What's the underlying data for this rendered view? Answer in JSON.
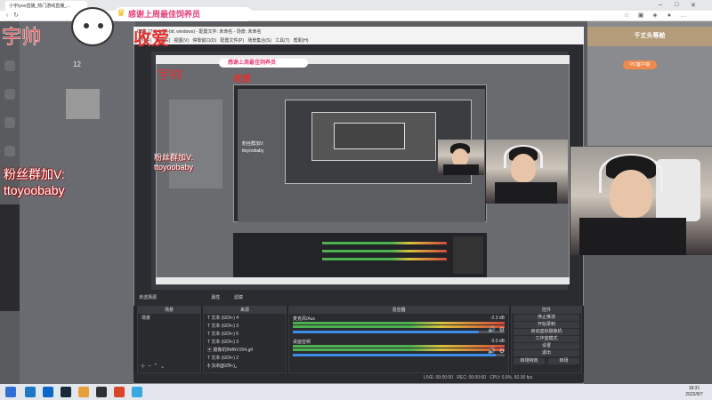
{
  "browser": {
    "tab_title": "小宇tyoo直播_热门游戏直播_...",
    "title_icons": [
      "minimize-icon",
      "maximize-icon",
      "close-icon"
    ]
  },
  "overlay": {
    "streamer_name": "宇帅",
    "gift_text": "收爱",
    "banner_text": "感谢上周最佳饲养员",
    "fan_group_label": "粉丝群加V:",
    "fan_group_id": "ttoyoobaby"
  },
  "page": {
    "left_count": "12",
    "right_banner": "千丈头等舱",
    "pc_button": "PC客户端"
  },
  "obs": {
    "title": "OBS 27.2.4 (64-bit, windows) - 配置文件: 未命名 - 场景: 未命名",
    "menu": [
      "文件(F)",
      "编辑(E)",
      "视图(V)",
      "停靠窗口(D)",
      "配置文件(P)",
      "场景集合(S)",
      "工具(T)",
      "帮助(H)"
    ],
    "no_source_label": "未选择源",
    "properties_label": "属性",
    "filters_label": "滤镜",
    "scenes": {
      "header": "场景",
      "items": [
        "场景"
      ]
    },
    "sources": {
      "header": "来源",
      "items": [
        "文本 (GDI+) 4",
        "文本 (GDI+) 3",
        "文本 (GDI+) 5",
        "文本 (GDI+) 3",
        "摄像机BMNV204.gif",
        "文本 (GDI+) 2",
        "文本 (GDI+)"
      ]
    },
    "mixer": {
      "header": "混音器",
      "tracks": [
        {
          "name": "麦克风/Aux",
          "db": "-2.3 dB"
        },
        {
          "name": "桌面音频",
          "db": "0.0 dB"
        }
      ]
    },
    "controls": {
      "header": "控件",
      "buttons": [
        "停止推流",
        "开始录制",
        "启动虚拟摄像机",
        "工作室模式",
        "设置",
        "退出"
      ]
    },
    "transition": {
      "label": "转场特效",
      "button": "转场"
    },
    "status": {
      "live": "LIVE: 00:00:00",
      "rec": "REC: 00:00:00",
      "cpu": "CPU: 0.0%, 60.00 fps"
    }
  },
  "taskbar": {
    "time": "18:31",
    "date": "2022/9/7"
  },
  "colors": {
    "overlay_red": "#e23030",
    "banner_pink": "#e63f7a",
    "obs_bg": "#2b2c30",
    "meter_green": "#4caf50"
  }
}
